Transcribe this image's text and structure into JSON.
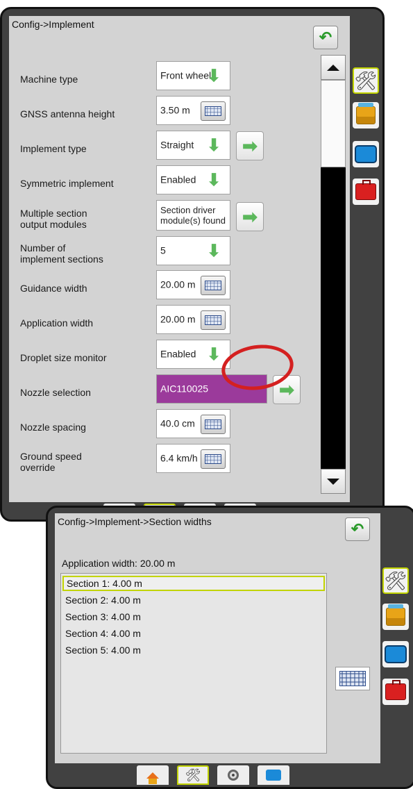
{
  "implement": {
    "title": "Config->Implement",
    "rows": [
      {
        "label": "Machine type",
        "value": "Front wheel"
      },
      {
        "label": "GNSS antenna height",
        "value": "3.50 m"
      },
      {
        "label": "Implement type",
        "value": "Straight"
      },
      {
        "label": "Symmetric implement",
        "value": "Enabled"
      },
      {
        "label": "Multiple section\noutput modules",
        "value": "Section driver\nmodule(s) found"
      },
      {
        "label": "Number of\nimplement sections",
        "value": "5"
      },
      {
        "label": "Guidance width",
        "value": "20.00 m"
      },
      {
        "label": "Application width",
        "value": "20.00 m"
      },
      {
        "label": "Droplet size monitor",
        "value": "Enabled"
      },
      {
        "label": "Nozzle selection",
        "value": "AIC110025"
      },
      {
        "label": "Nozzle spacing",
        "value": "40.0 cm"
      },
      {
        "label": "Ground speed\noverride",
        "value": "6.4 km/h"
      }
    ]
  },
  "section_widths": {
    "title": "Config->Implement->Section widths",
    "application_width": "Application width: 20.00 m",
    "sections": [
      "Section 1: 4.00 m",
      "Section 2: 4.00 m",
      "Section 3: 4.00 m",
      "Section 4: 4.00 m",
      "Section 5: 4.00 m"
    ]
  },
  "glyphs": {
    "back": "↶",
    "download": "⬇",
    "arrow": "➡",
    "tools": "🛠"
  },
  "colors": {
    "accent": "#c2d400",
    "nozzle_highlight": "#9b3a9b",
    "annotation_circle": "#d42020"
  }
}
